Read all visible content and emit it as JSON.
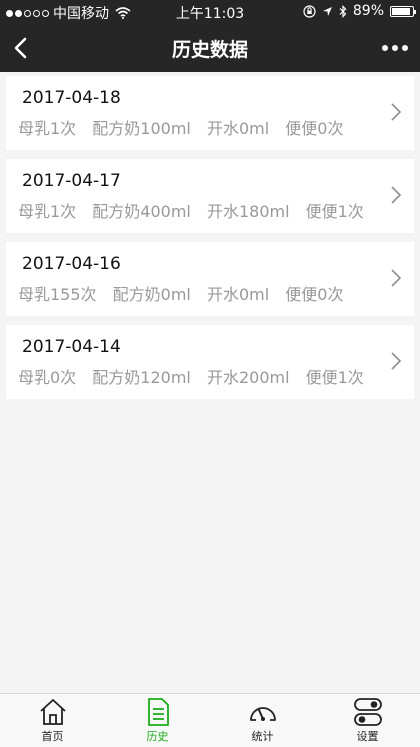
{
  "status_bar": {
    "carrier": "中国移动",
    "time": "上午11:03",
    "battery": "89%",
    "battery_level": 0.89
  },
  "nav": {
    "title": "历史数据"
  },
  "records": [
    {
      "date": "2017-04-18",
      "breast": "母乳1次",
      "formula": "配方奶100ml",
      "water": "开水0ml",
      "stool": "便便0次"
    },
    {
      "date": "2017-04-17",
      "breast": "母乳1次",
      "formula": "配方奶400ml",
      "water": "开水180ml",
      "stool": "便便1次"
    },
    {
      "date": "2017-04-16",
      "breast": "母乳155次",
      "formula": "配方奶0ml",
      "water": "开水0ml",
      "stool": "便便0次"
    },
    {
      "date": "2017-04-14",
      "breast": "母乳0次",
      "formula": "配方奶120ml",
      "water": "开水200ml",
      "stool": "便便1次"
    }
  ],
  "tabs": [
    {
      "label": "首页",
      "icon": "home-icon",
      "active": false
    },
    {
      "label": "历史",
      "icon": "document-icon",
      "active": true
    },
    {
      "label": "统计",
      "icon": "gauge-icon",
      "active": false
    },
    {
      "label": "设置",
      "icon": "toggle-icon",
      "active": false
    }
  ],
  "colors": {
    "bar_bg": "#262626",
    "accent": "#19ad19",
    "muted_text": "#999999"
  }
}
